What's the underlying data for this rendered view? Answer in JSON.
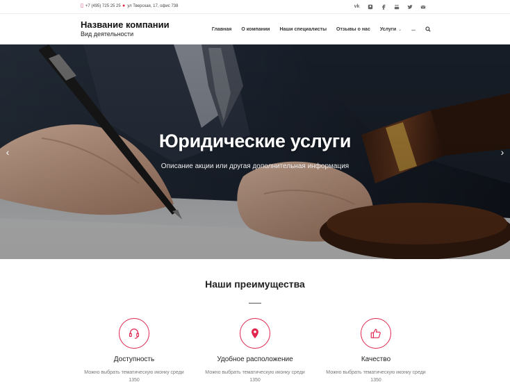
{
  "topbar": {
    "phone": "+7 (495) 725 25 25",
    "address": "ул Тверская, 17, офис 738",
    "socials": [
      "vk-icon",
      "odnoklassniki-icon",
      "facebook-icon",
      "youtube-icon",
      "twitter-icon",
      "email-icon"
    ],
    "social_labels": {
      "vk": "vk"
    }
  },
  "header": {
    "company_name": "Название компании",
    "company_activity": "Вид деятельности"
  },
  "nav": {
    "items": [
      "Главная",
      "О компании",
      "Наши специалисты",
      "Отзывы о нас",
      "Услуги",
      "..."
    ]
  },
  "hero": {
    "title": "Юридические услуги",
    "subtitle": "Описание акции или другая дополнительная информация"
  },
  "advantages": {
    "title": "Наши преимущества",
    "items": [
      {
        "icon": "headset-icon",
        "title": "Доступность",
        "desc": "Можно выбрать тематическую иконку среди 1350"
      },
      {
        "icon": "map-pin-icon",
        "title": "Удобное расположение",
        "desc": "Можно выбрать тематическую иконку среди 1350"
      },
      {
        "icon": "thumbs-up-icon",
        "title": "Качество",
        "desc": "Можно выбрать тематическую иконку среди 1350"
      }
    ]
  },
  "colors": {
    "accent": "#e0264f",
    "text": "#222222"
  }
}
